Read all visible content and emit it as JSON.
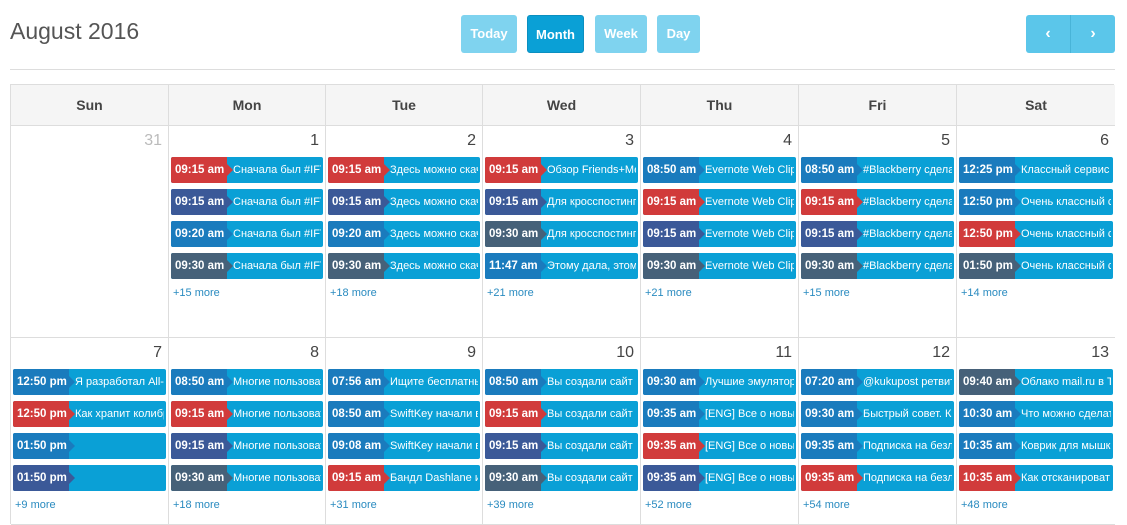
{
  "header": {
    "title": "August 2016",
    "view_buttons": [
      "Today",
      "Month",
      "Week",
      "Day"
    ],
    "active_view": "Month",
    "prev_label": "‹",
    "next_label": "›"
  },
  "colors": {
    "red": "#d13b3b",
    "navy": "#3b5998",
    "blue": "#1a7bbd",
    "slate": "#466179",
    "event_bg": "#0aa0d6"
  },
  "weekdays": [
    "Sun",
    "Mon",
    "Tue",
    "Wed",
    "Thu",
    "Fri",
    "Sat"
  ],
  "weeks": [
    {
      "days": [
        {
          "num": "31",
          "other": true,
          "events": [],
          "more": ""
        },
        {
          "num": "1",
          "events": [
            {
              "time": "09:15 am",
              "text": "Сначала был #IFTTT",
              "color": "red"
            },
            {
              "time": "09:15 am",
              "text": "Сначала был #IFTTT",
              "color": "navy"
            },
            {
              "time": "09:20 am",
              "text": "Сначала был #IFTTT",
              "color": "blue"
            },
            {
              "time": "09:30 am",
              "text": "Сначала был #IFTTT",
              "color": "slate"
            }
          ],
          "more": "+15 more"
        },
        {
          "num": "2",
          "events": [
            {
              "time": "09:15 am",
              "text": "Здесь можно скачать",
              "color": "red"
            },
            {
              "time": "09:15 am",
              "text": "Здесь можно скачать",
              "color": "navy"
            },
            {
              "time": "09:20 am",
              "text": "Здесь можно скачать",
              "color": "blue"
            },
            {
              "time": "09:30 am",
              "text": "Здесь можно скачать",
              "color": "slate"
            }
          ],
          "more": "+18 more"
        },
        {
          "num": "3",
          "events": [
            {
              "time": "09:15 am",
              "text": "Обзор Friends+Me.",
              "color": "red"
            },
            {
              "time": "09:15 am",
              "text": "Для кросспостинга",
              "color": "navy"
            },
            {
              "time": "09:30 am",
              "text": "Для кросспостинга",
              "color": "slate"
            },
            {
              "time": "11:47 am",
              "text": "Этому дала, этому",
              "color": "blue"
            }
          ],
          "more": "+21 more"
        },
        {
          "num": "4",
          "events": [
            {
              "time": "08:50 am",
              "text": "Evernote Web Clipper",
              "color": "blue"
            },
            {
              "time": "09:15 am",
              "text": "Evernote Web Clipper",
              "color": "red"
            },
            {
              "time": "09:15 am",
              "text": "Evernote Web Clipper",
              "color": "navy"
            },
            {
              "time": "09:30 am",
              "text": "Evernote Web Clipper",
              "color": "slate"
            }
          ],
          "more": "+21 more"
        },
        {
          "num": "5",
          "events": [
            {
              "time": "08:50 am",
              "text": "#Blackberry сделала",
              "color": "blue"
            },
            {
              "time": "09:15 am",
              "text": "#Blackberry сделала",
              "color": "red"
            },
            {
              "time": "09:15 am",
              "text": "#Blackberry сделала",
              "color": "navy"
            },
            {
              "time": "09:30 am",
              "text": "#Blackberry сделала",
              "color": "slate"
            }
          ],
          "more": "+15 more"
        },
        {
          "num": "6",
          "events": [
            {
              "time": "12:25 pm",
              "text": "Классный сервис для",
              "color": "blue"
            },
            {
              "time": "12:50 pm",
              "text": "Очень классный сервис",
              "color": "blue"
            },
            {
              "time": "12:50 pm",
              "text": "Очень классный сервис",
              "color": "red"
            },
            {
              "time": "01:50 pm",
              "text": "Очень классный сервис",
              "color": "slate"
            }
          ],
          "more": "+14 more"
        }
      ]
    },
    {
      "days": [
        {
          "num": "7",
          "events": [
            {
              "time": "12:50 pm",
              "text": "Я разработал All-in-one",
              "color": "blue"
            },
            {
              "time": "12:50 pm",
              "text": "Как храпит колибри",
              "color": "red"
            },
            {
              "time": "01:50 pm",
              "text": "",
              "color": "blue"
            },
            {
              "time": "01:50 pm",
              "text": "",
              "color": "navy"
            }
          ],
          "more": "+9 more"
        },
        {
          "num": "8",
          "events": [
            {
              "time": "08:50 am",
              "text": "Многие пользователи",
              "color": "blue"
            },
            {
              "time": "09:15 am",
              "text": "Многие пользователи",
              "color": "red"
            },
            {
              "time": "09:15 am",
              "text": "Многие пользователи",
              "color": "navy"
            },
            {
              "time": "09:30 am",
              "text": "Многие пользователи",
              "color": "slate"
            }
          ],
          "more": "+18 more"
        },
        {
          "num": "9",
          "events": [
            {
              "time": "07:56 am",
              "text": "Ищите бесплатный",
              "color": "blue"
            },
            {
              "time": "08:50 am",
              "text": "SwiftKey начали вы",
              "color": "blue"
            },
            {
              "time": "09:08 am",
              "text": "SwiftKey начали вы",
              "color": "blue"
            },
            {
              "time": "09:15 am",
              "text": "Бандл Dashlane и L",
              "color": "red"
            }
          ],
          "more": "+31 more"
        },
        {
          "num": "10",
          "events": [
            {
              "time": "08:50 am",
              "text": "Вы создали сайт и",
              "color": "blue"
            },
            {
              "time": "09:15 am",
              "text": "Вы создали сайт и",
              "color": "red"
            },
            {
              "time": "09:15 am",
              "text": "Вы создали сайт и",
              "color": "navy"
            },
            {
              "time": "09:30 am",
              "text": "Вы создали сайт и",
              "color": "slate"
            }
          ],
          "more": "+39 more"
        },
        {
          "num": "11",
          "events": [
            {
              "time": "09:30 am",
              "text": "Лучшие эмуляторы",
              "color": "blue"
            },
            {
              "time": "09:35 am",
              "text": "[ENG] Все о новых",
              "color": "blue"
            },
            {
              "time": "09:35 am",
              "text": "[ENG] Все о новых",
              "color": "red"
            },
            {
              "time": "09:35 am",
              "text": "[ENG] Все о новых",
              "color": "navy"
            }
          ],
          "more": "+52 more"
        },
        {
          "num": "12",
          "events": [
            {
              "time": "07:20 am",
              "text": "@kukupost ретвит",
              "color": "blue"
            },
            {
              "time": "09:30 am",
              "text": "Быстрый совет. Ка",
              "color": "blue"
            },
            {
              "time": "09:35 am",
              "text": "Подписка на безл",
              "color": "blue"
            },
            {
              "time": "09:35 am",
              "text": "Подписка на безл",
              "color": "red"
            }
          ],
          "more": "+54 more"
        },
        {
          "num": "13",
          "events": [
            {
              "time": "09:40 am",
              "text": "Облако mail.ru в То",
              "color": "slate"
            },
            {
              "time": "10:30 am",
              "text": "Что можно сделат",
              "color": "blue"
            },
            {
              "time": "10:35 am",
              "text": "Коврик для мышки",
              "color": "blue"
            },
            {
              "time": "10:35 am",
              "text": "Как отсканироват",
              "color": "red"
            }
          ],
          "more": "+48 more"
        }
      ]
    }
  ]
}
